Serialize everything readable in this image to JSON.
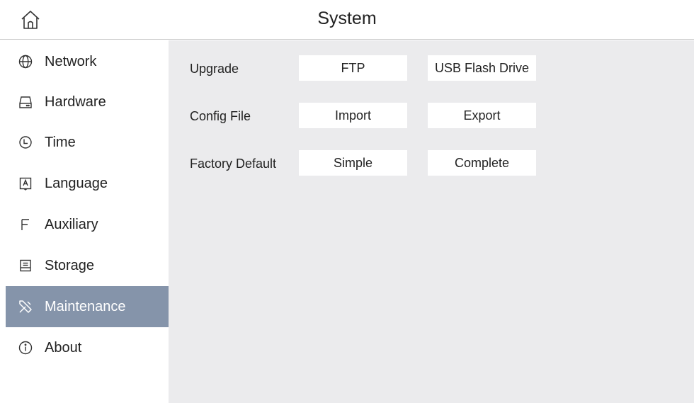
{
  "header": {
    "title": "System"
  },
  "sidebar": {
    "items": [
      {
        "label": "Network",
        "icon": "globe-icon"
      },
      {
        "label": "Hardware",
        "icon": "hard-drive-icon"
      },
      {
        "label": "Time",
        "icon": "clock-icon"
      },
      {
        "label": "Language",
        "icon": "language-icon"
      },
      {
        "label": "Auxiliary",
        "icon": "auxiliary-icon"
      },
      {
        "label": "Storage",
        "icon": "storage-icon"
      },
      {
        "label": "Maintenance",
        "icon": "tools-icon",
        "active": true
      },
      {
        "label": "About",
        "icon": "info-icon"
      }
    ]
  },
  "main": {
    "upgrade": {
      "label": "Upgrade",
      "options": [
        "FTP",
        "USB Flash Drive"
      ]
    },
    "config_file": {
      "label": "Config File",
      "options": [
        "Import",
        "Export"
      ]
    },
    "factory_default": {
      "label": "Factory Default",
      "options": [
        "Simple",
        "Complete"
      ]
    }
  },
  "colors": {
    "active_bg": "#8594aa",
    "content_bg": "#ebebed",
    "divider": "#c8c8c8"
  }
}
